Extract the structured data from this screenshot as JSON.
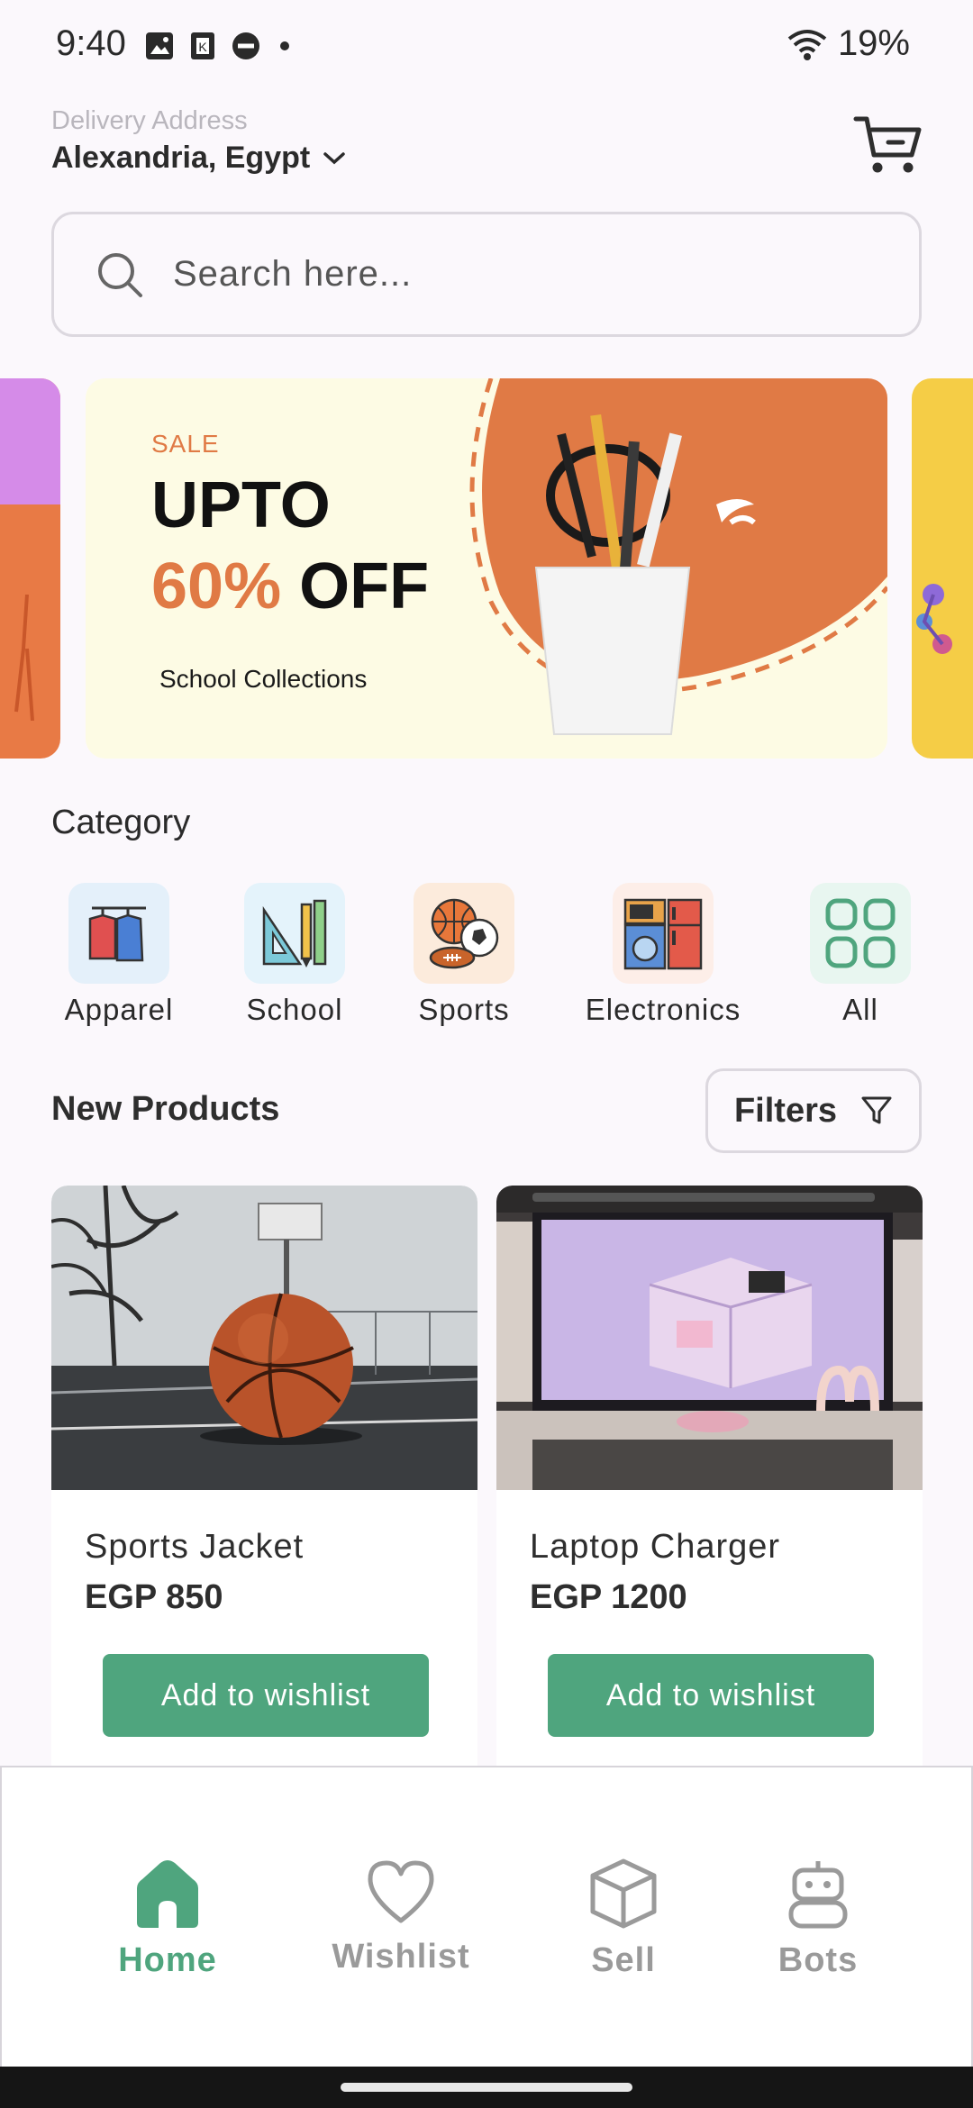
{
  "status_bar": {
    "time": "9:40",
    "battery": "19%"
  },
  "header": {
    "delivery_label": "Delivery Address",
    "delivery_city": "Alexandria, Egypt"
  },
  "search": {
    "placeholder": "Search here..."
  },
  "banner": {
    "sale_label": "SALE",
    "line1": "UPTO",
    "line2_percent": "60%",
    "line2_rest": "OFF",
    "subtitle": "School Collections",
    "accent_color": "#e07a45"
  },
  "category": {
    "title": "Category",
    "items": [
      {
        "label": "Apparel",
        "icon": "hanging-clothes-icon"
      },
      {
        "label": "School",
        "icon": "ruler-pencil-icon"
      },
      {
        "label": "Sports",
        "icon": "sports-balls-icon"
      },
      {
        "label": "Electronics",
        "icon": "appliances-icon"
      },
      {
        "label": "All",
        "icon": "grid-icon"
      }
    ]
  },
  "new_products": {
    "title": "New Products",
    "filters_label": "Filters",
    "products": [
      {
        "name": "Sports Jacket",
        "price": "EGP 850",
        "button": "Add to wishlist",
        "image": "basketball-photo"
      },
      {
        "name": "Laptop Charger",
        "price": "EGP 1200",
        "button": "Add to wishlist",
        "image": "desk-monitor-photo"
      }
    ]
  },
  "bottom_nav": {
    "items": [
      {
        "label": "Home",
        "icon": "home-icon",
        "active": true
      },
      {
        "label": "Wishlist",
        "icon": "heart-icon",
        "active": false
      },
      {
        "label": "Sell",
        "icon": "box-icon",
        "active": false
      },
      {
        "label": "Bots",
        "icon": "robot-icon",
        "active": false
      }
    ],
    "active_color": "#4fa57e"
  }
}
